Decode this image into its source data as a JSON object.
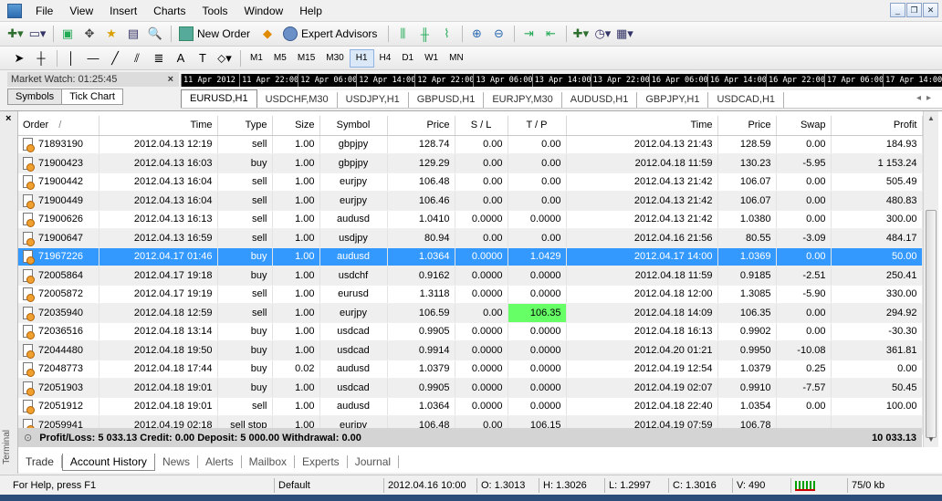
{
  "menu": [
    "File",
    "View",
    "Insert",
    "Charts",
    "Tools",
    "Window",
    "Help"
  ],
  "toolbar": {
    "new_order": "New Order",
    "expert_advisors": "Expert Advisors"
  },
  "timeframes": [
    "M1",
    "M5",
    "M15",
    "M30",
    "H1",
    "H4",
    "D1",
    "W1",
    "MN"
  ],
  "active_timeframe": "H1",
  "market_watch": {
    "title": "Market Watch: 01:25:45",
    "tabs": [
      "Symbols",
      "Tick Chart"
    ],
    "active_tab": "Tick Chart"
  },
  "timeline": [
    "11 Apr 2012",
    "11 Apr 22:00",
    "12 Apr 06:00",
    "12 Apr 14:00",
    "12 Apr 22:00",
    "13 Apr 06:00",
    "13 Apr 14:00",
    "13 Apr 22:00",
    "16 Apr 06:00",
    "16 Apr 14:00",
    "16 Apr 22:00",
    "17 Apr 06:00",
    "17 Apr 14:00"
  ],
  "chart_tabs": [
    "EURUSD,H1",
    "USDCHF,M30",
    "USDJPY,H1",
    "GBPUSD,H1",
    "EURJPY,M30",
    "AUDUSD,H1",
    "GBPJPY,H1",
    "USDCAD,H1"
  ],
  "active_chart_tab": "EURUSD,H1",
  "columns": [
    "Order",
    "/",
    "Time",
    "Type",
    "Size",
    "Symbol",
    "Price",
    "S / L",
    "T / P",
    "Time",
    "Price",
    "Swap",
    "Profit"
  ],
  "rows": [
    [
      "71893190",
      "2012.04.13 12:19",
      "sell",
      "1.00",
      "gbpjpy",
      "128.74",
      "0.00",
      "0.00",
      "2012.04.13 21:43",
      "128.59",
      "0.00",
      "184.93"
    ],
    [
      "71900423",
      "2012.04.13 16:03",
      "buy",
      "1.00",
      "gbpjpy",
      "129.29",
      "0.00",
      "0.00",
      "2012.04.18 11:59",
      "130.23",
      "-5.95",
      "1 153.24"
    ],
    [
      "71900442",
      "2012.04.13 16:04",
      "sell",
      "1.00",
      "eurjpy",
      "106.48",
      "0.00",
      "0.00",
      "2012.04.13 21:42",
      "106.07",
      "0.00",
      "505.49"
    ],
    [
      "71900449",
      "2012.04.13 16:04",
      "sell",
      "1.00",
      "eurjpy",
      "106.46",
      "0.00",
      "0.00",
      "2012.04.13 21:42",
      "106.07",
      "0.00",
      "480.83"
    ],
    [
      "71900626",
      "2012.04.13 16:13",
      "sell",
      "1.00",
      "audusd",
      "1.0410",
      "0.0000",
      "0.0000",
      "2012.04.13 21:42",
      "1.0380",
      "0.00",
      "300.00"
    ],
    [
      "71900647",
      "2012.04.13 16:59",
      "sell",
      "1.00",
      "usdjpy",
      "80.94",
      "0.00",
      "0.00",
      "2012.04.16 21:56",
      "80.55",
      "-3.09",
      "484.17"
    ],
    [
      "71967226",
      "2012.04.17 01:46",
      "buy",
      "1.00",
      "audusd",
      "1.0364",
      "0.0000",
      "1.0429",
      "2012.04.17 14:00",
      "1.0369",
      "0.00",
      "50.00"
    ],
    [
      "72005864",
      "2012.04.17 19:18",
      "buy",
      "1.00",
      "usdchf",
      "0.9162",
      "0.0000",
      "0.0000",
      "2012.04.18 11:59",
      "0.9185",
      "-2.51",
      "250.41"
    ],
    [
      "72005872",
      "2012.04.17 19:19",
      "sell",
      "1.00",
      "eurusd",
      "1.3118",
      "0.0000",
      "0.0000",
      "2012.04.18 12:00",
      "1.3085",
      "-5.90",
      "330.00"
    ],
    [
      "72035940",
      "2012.04.18 12:59",
      "sell",
      "1.00",
      "eurjpy",
      "106.59",
      "0.00",
      "106.35",
      "2012.04.18 14:09",
      "106.35",
      "0.00",
      "294.92"
    ],
    [
      "72036516",
      "2012.04.18 13:14",
      "buy",
      "1.00",
      "usdcad",
      "0.9905",
      "0.0000",
      "0.0000",
      "2012.04.18 16:13",
      "0.9902",
      "0.00",
      "-30.30"
    ],
    [
      "72044480",
      "2012.04.18 19:50",
      "buy",
      "1.00",
      "usdcad",
      "0.9914",
      "0.0000",
      "0.0000",
      "2012.04.20 01:21",
      "0.9950",
      "-10.08",
      "361.81"
    ],
    [
      "72048773",
      "2012.04.18 17:44",
      "buy",
      "0.02",
      "audusd",
      "1.0379",
      "0.0000",
      "0.0000",
      "2012.04.19 12:54",
      "1.0379",
      "0.25",
      "0.00"
    ],
    [
      "72051903",
      "2012.04.18 19:01",
      "buy",
      "1.00",
      "usdcad",
      "0.9905",
      "0.0000",
      "0.0000",
      "2012.04.19 02:07",
      "0.9910",
      "-7.57",
      "50.45"
    ],
    [
      "72051912",
      "2012.04.18 19:01",
      "sell",
      "1.00",
      "audusd",
      "1.0364",
      "0.0000",
      "0.0000",
      "2012.04.18 22:40",
      "1.0354",
      "0.00",
      "100.00"
    ],
    [
      "72059941",
      "2012.04.19 02:18",
      "sell stop",
      "1.00",
      "eurjpy",
      "106.48",
      "0.00",
      "106.15",
      "2012.04.19 07:59",
      "106.78",
      "",
      ""
    ]
  ],
  "selected_row": 6,
  "highlighted_tp_row": 9,
  "summary": {
    "text": "Profit/Loss: 5 033.13  Credit: 0.00  Deposit: 5 000.00  Withdrawal: 0.00",
    "total": "10 033.13"
  },
  "bottom_tabs": [
    "Trade",
    "Account History",
    "News",
    "Alerts",
    "Mailbox",
    "Experts",
    "Journal"
  ],
  "active_bottom_tab": "Account History",
  "side_label": "Terminal",
  "status": {
    "help": "For Help, press F1",
    "profile": "Default",
    "datetime": "2012.04.16 10:00",
    "open": "O: 1.3013",
    "high": "H: 1.3026",
    "low": "L: 1.2997",
    "close": "C: 1.3016",
    "volume": "V: 490",
    "traffic": "75/0 kb"
  }
}
